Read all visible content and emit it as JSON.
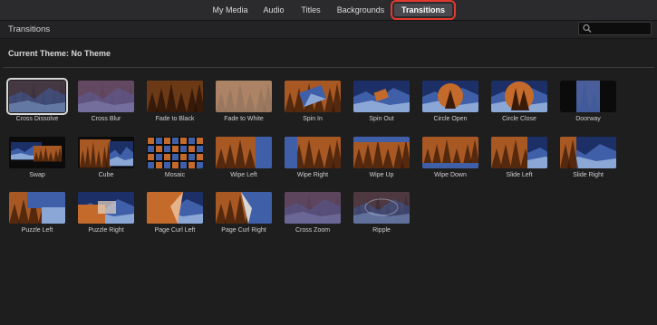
{
  "tabs": [
    "My Media",
    "Audio",
    "Titles",
    "Backgrounds",
    "Transitions"
  ],
  "header": {
    "title": "Transitions"
  },
  "theme_label": "Current Theme: No Theme",
  "transitions": [
    "Cross Dissolve",
    "Cross Blur",
    "Fade to Black",
    "Fade to White",
    "Spin In",
    "Spin Out",
    "Circle Open",
    "Circle Close",
    "Doorway",
    "Swap",
    "Cube",
    "Mosaic",
    "Wipe Left",
    "Wipe Right",
    "Wipe Up",
    "Wipe Down",
    "Slide Left",
    "Slide Right",
    "Puzzle Left",
    "Puzzle Right",
    "Page Curl Left",
    "Page Curl Right",
    "Cross Zoom",
    "Ripple"
  ],
  "selected": "Cross Dissolve",
  "colors": {
    "accent_outline": "#e0392f",
    "forest": "#c46a2a",
    "mountain": "#3f5fa8"
  }
}
